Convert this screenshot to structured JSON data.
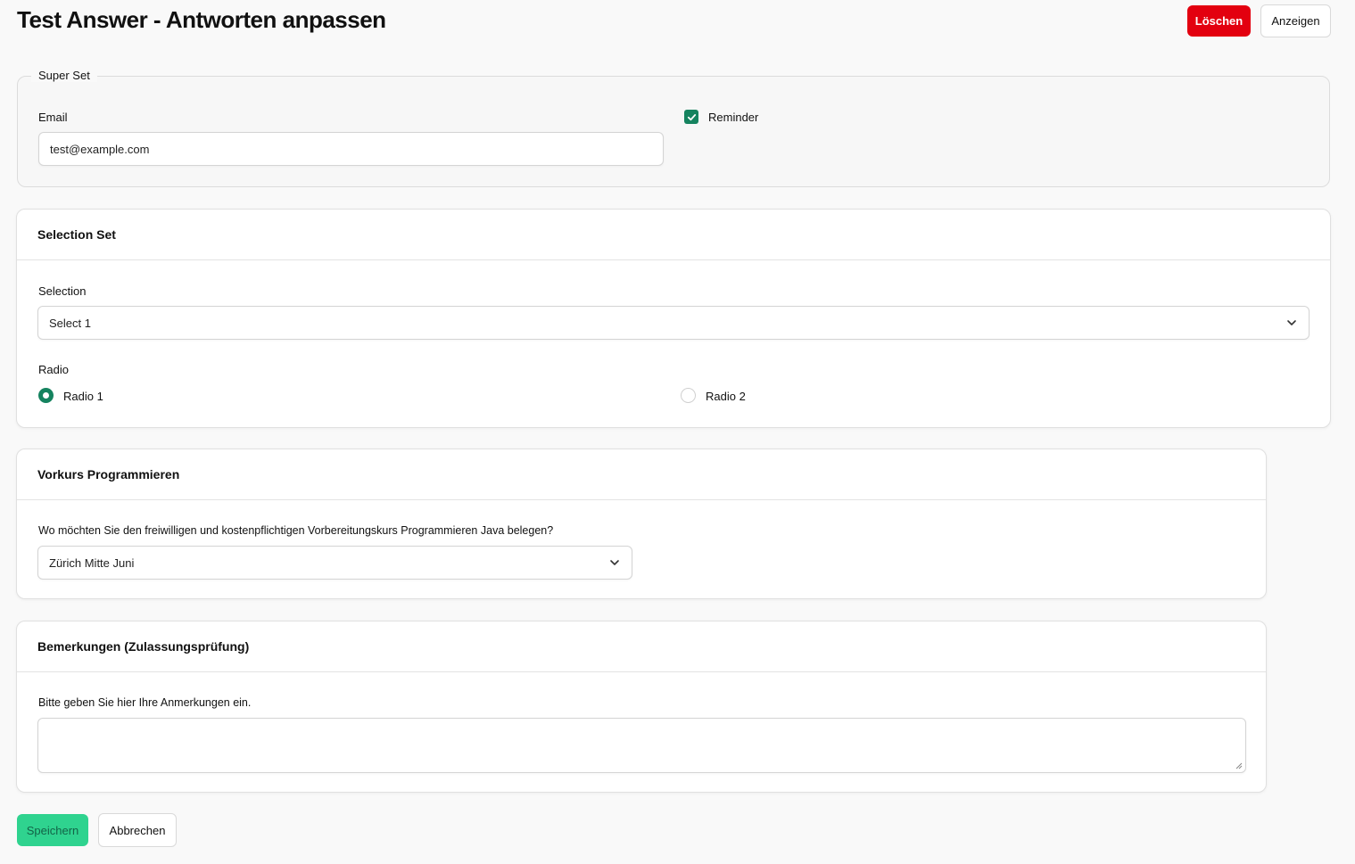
{
  "header": {
    "title": "Test Answer - Antworten anpassen",
    "delete_label": "Löschen",
    "show_label": "Anzeigen"
  },
  "super_set": {
    "legend": "Super Set",
    "email_label": "Email",
    "email_value": "test@example.com",
    "reminder_label": "Reminder",
    "reminder_checked": true
  },
  "selection_set": {
    "title": "Selection Set",
    "selection_label": "Selection",
    "selection_value": "Select 1",
    "radio_label": "Radio",
    "radio_options": [
      "Radio 1",
      "Radio 2"
    ],
    "radio_selected": "Radio 1"
  },
  "vorkurs": {
    "title": "Vorkurs Programmieren",
    "question": "Wo möchten Sie den freiwilligen und kostenpflichtigen Vorbereitungskurs Programmieren Java belegen?",
    "value": "Zürich Mitte Juni"
  },
  "bemerkungen": {
    "title": "Bemerkungen (Zulassungsprüfung)",
    "question": "Bitte geben Sie hier Ihre Anmerkungen ein.",
    "value": ""
  },
  "footer": {
    "save_label": "Speichern",
    "cancel_label": "Abbrechen"
  },
  "colors": {
    "accent": "#15835f",
    "danger": "#e3000f",
    "save": "#2fd38f"
  }
}
